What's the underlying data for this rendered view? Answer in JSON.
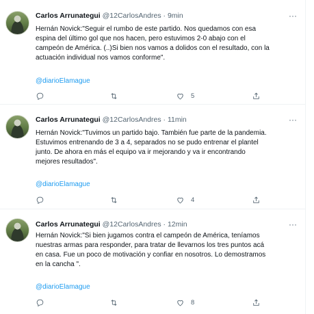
{
  "tweets": [
    {
      "name": "Carlos Arrunategui",
      "handle": "@12CarlosAndres",
      "separator": "·",
      "time": "9min",
      "text": "Hernán Novick:\"Seguir el rumbo de este partido. Nos quedamos con esa\nespina del último gol que nos hacen, pero estuvimos 2-0 abajo con el\ncampeón de América. (..)Si bien nos vamos a dolidos con el resultado, con la\nactuación individual nos vamos conforme\".",
      "link": "@diarioElamague",
      "likes": "5"
    },
    {
      "name": "Carlos Arrunategui",
      "handle": "@12CarlosAndres",
      "separator": "·",
      "time": "11min",
      "text": "Hernán Novick:\"Tuvimos un partido bajo. También fue parte de la pandemia.\nEstuvimos entrenando de 3 a 4, separados no se pudo entrenar el plantel\njunto. De ahora en más el equipo va ir mejorando y va ir encontrando\nmejores resultados\".",
      "link": "@diarioElamague",
      "likes": "4"
    },
    {
      "name": "Carlos Arrunategui",
      "handle": "@12CarlosAndres",
      "separator": "·",
      "time": "12min",
      "text": "Hernán Novick:\"Si bien jugamos contra el campeón de América, teníamos\nnuestras armas para responder, para tratar de llevarnos los tres puntos acá\nen casa. Fue un poco de motivación y confiar en nosotros. Lo demostramos\nen la cancha \".",
      "link": "@diarioElamague",
      "likes": "8"
    }
  ],
  "icons": {
    "more": "more-dots-icon",
    "reply": "reply-icon",
    "retweet": "retweet-icon",
    "like": "heart-icon",
    "share": "share-icon"
  },
  "colors": {
    "link": "#1d9bf0",
    "secondary": "#536471",
    "text": "#0f1419"
  }
}
